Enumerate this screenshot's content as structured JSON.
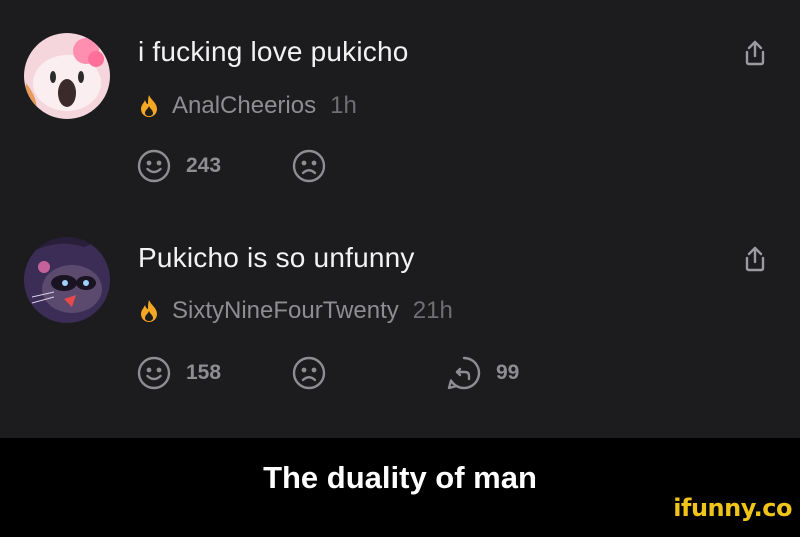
{
  "posts": [
    {
      "title": "i fucking love pukicho",
      "username": "AnalCheerios",
      "time": "1h",
      "smile_count": "243",
      "icons": {
        "avatar": "hello-kitty-avatar",
        "badge": "flame-icon",
        "share": "share-icon"
      }
    },
    {
      "title": "Pukicho is so unfunny",
      "username": "SixtyNineFourTwenty",
      "time": "21h",
      "smile_count": "158",
      "reply_count": "99",
      "icons": {
        "avatar": "raccoon-avatar",
        "badge": "flame-icon",
        "share": "share-icon"
      }
    }
  ],
  "caption": "The duality of man",
  "watermark": "ifunny.co",
  "colors": {
    "background": "#1c1c1f",
    "text_primary": "#f2f2f2",
    "text_secondary": "#8d8d92",
    "flame": "#f5a623",
    "watermark": "#f0c419"
  }
}
